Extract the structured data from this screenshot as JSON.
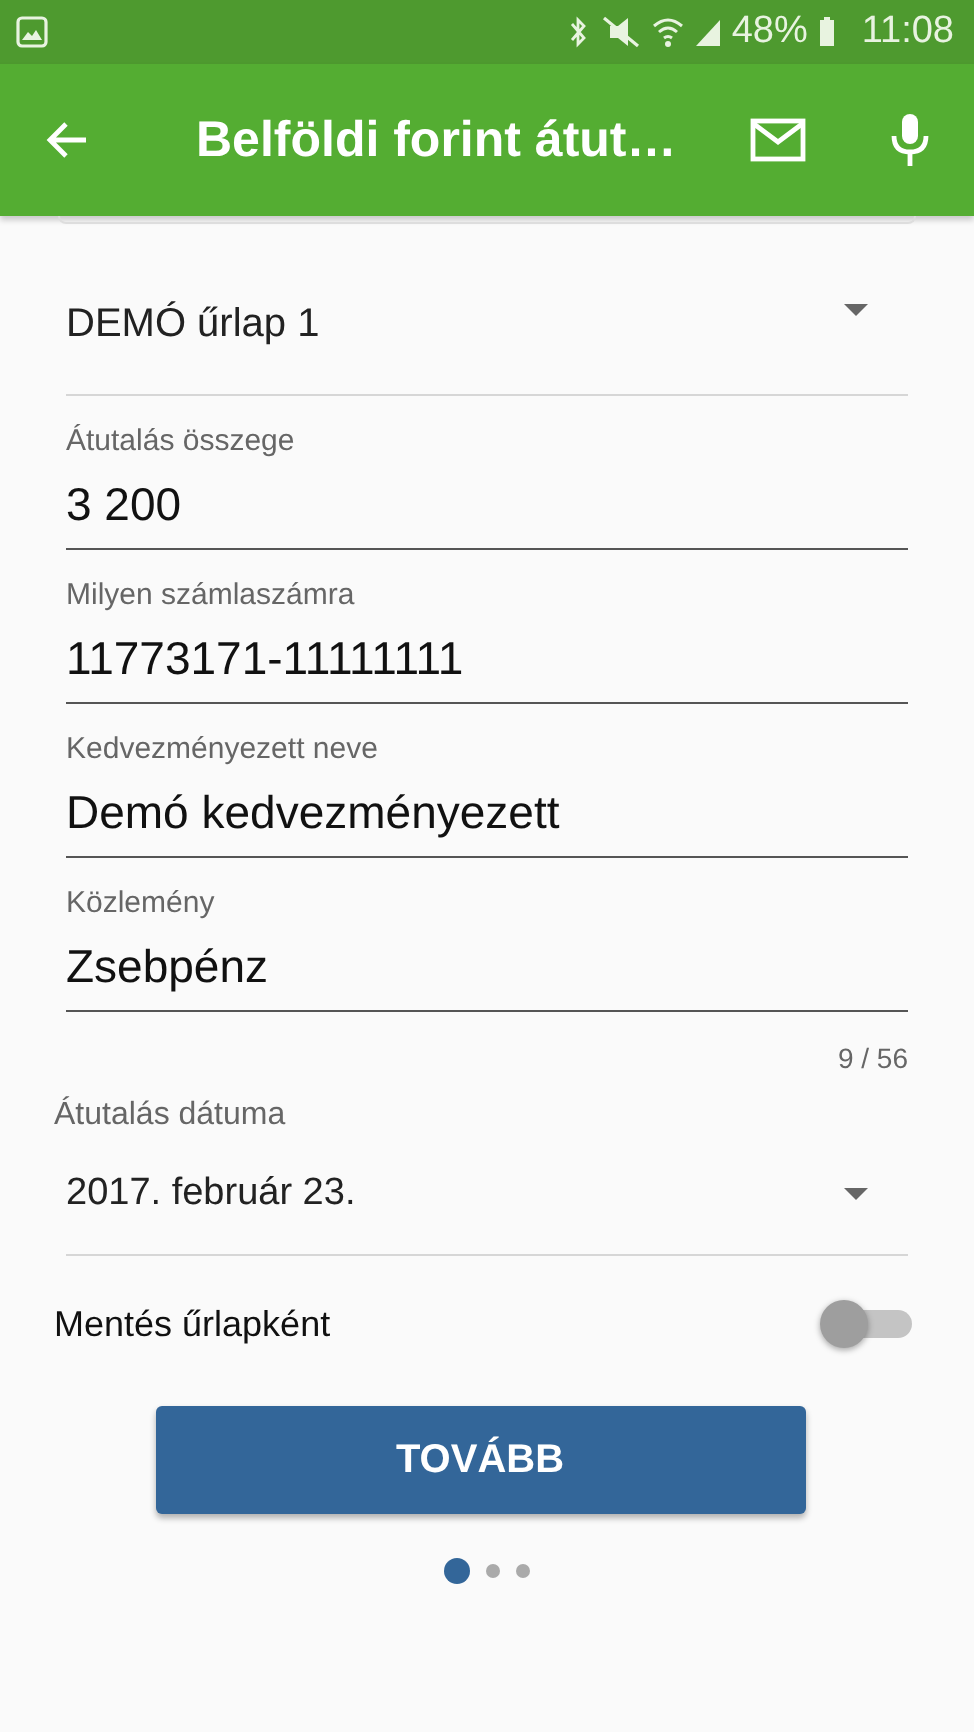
{
  "status_bar": {
    "battery": "48%",
    "time": "11:08"
  },
  "app_bar": {
    "title": "Belföldi forint átut…"
  },
  "template": {
    "value": "DEMÓ űrlap 1"
  },
  "fields": [
    {
      "label": "Átutalás összege",
      "value": "3 200"
    },
    {
      "label": "Milyen számlaszámra",
      "value": "11773171-11111111"
    },
    {
      "label": "Kedvezményezett neve",
      "value": "Demó kedvezményezett"
    },
    {
      "label": "Közlemény",
      "value": "Zsebpénz",
      "counter": "9 / 56"
    }
  ],
  "date": {
    "label": "Átutalás dátuma",
    "value": "2017. február 23."
  },
  "save_template": {
    "label": "Mentés űrlapként",
    "on": false
  },
  "next_button": "TOVÁBB",
  "pages": [
    {
      "selected": true
    },
    {
      "selected": false
    },
    {
      "selected": false
    }
  ]
}
